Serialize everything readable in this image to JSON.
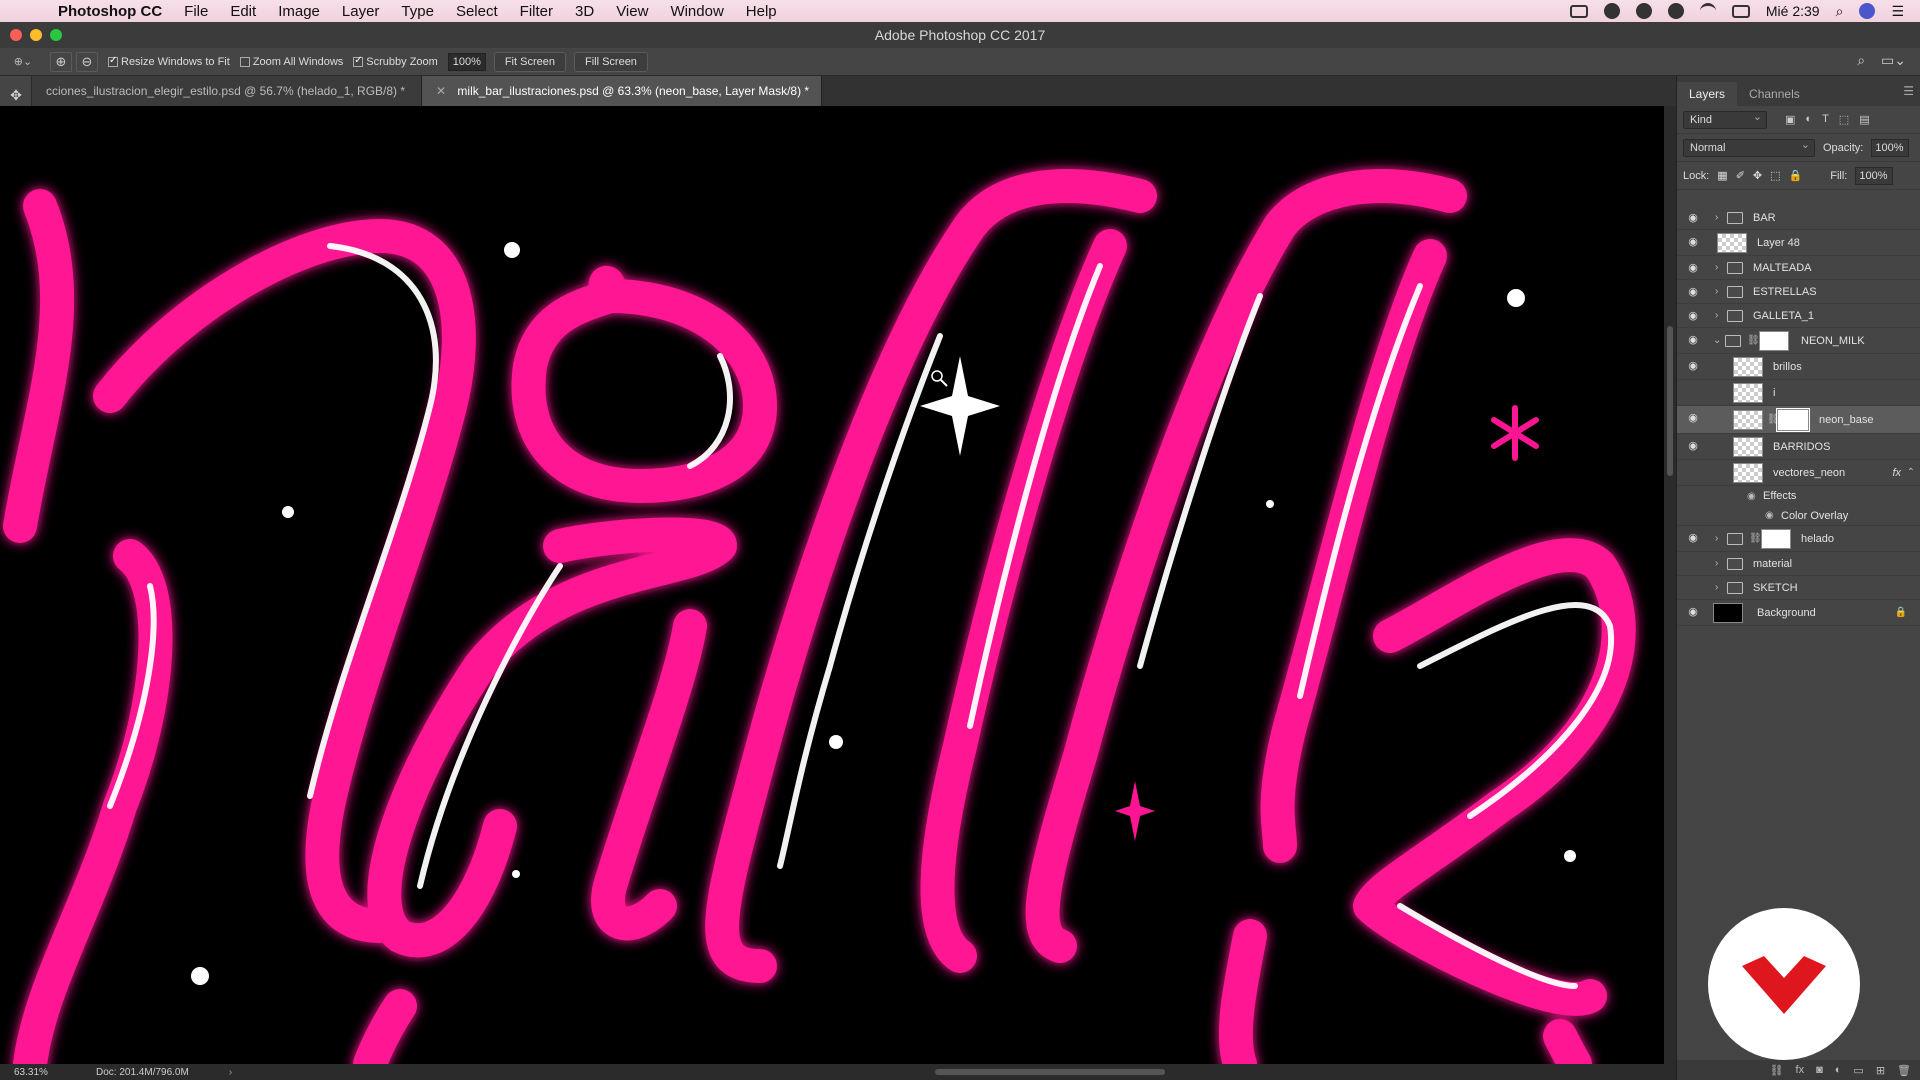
{
  "menubar": {
    "app_name": "Photoshop CC",
    "items": [
      "File",
      "Edit",
      "Image",
      "Layer",
      "Type",
      "Select",
      "Filter",
      "3D",
      "View",
      "Window",
      "Help"
    ],
    "clock": "Mié 2:39"
  },
  "window": {
    "title": "Adobe Photoshop CC 2017"
  },
  "options": {
    "resize_windows": "Resize Windows to Fit",
    "zoom_all": "Zoom All Windows",
    "scrubby_zoom": "Scrubby Zoom",
    "zoom_value": "100%",
    "fit_screen": "Fit Screen",
    "fill_screen": "Fill Screen"
  },
  "tabs": [
    {
      "label": "cciones_ilustracion_elegir_estilo.psd @ 56.7% (helado_1, RGB/8) *"
    },
    {
      "label": "milk_bar_ilustraciones.psd @ 63.3% (neon_base, Layer Mask/8) *"
    }
  ],
  "status": {
    "zoom": "63.31%",
    "doc": "Doc: 201.4M/796.0M"
  },
  "panel": {
    "tabs": [
      "Layers",
      "Channels"
    ],
    "filter_kind": "Kind",
    "blend_mode": "Normal",
    "opacity_label": "Opacity:",
    "opacity_value": "100%",
    "lock_label": "Lock:",
    "fill_label": "Fill:",
    "fill_value": "100%"
  },
  "layers": [
    {
      "name": "BAR"
    },
    {
      "name": "Layer 48"
    },
    {
      "name": "MALTEADA"
    },
    {
      "name": "ESTRELLAS"
    },
    {
      "name": "GALLETA_1"
    },
    {
      "name": "NEON_MILK"
    },
    {
      "name": "brillos"
    },
    {
      "name": "i"
    },
    {
      "name": "neon_base"
    },
    {
      "name": "BARRIDOS"
    },
    {
      "name": "vectores_neon"
    },
    {
      "name": "Effects"
    },
    {
      "name": "Color Overlay"
    },
    {
      "name": "helado"
    },
    {
      "name": "material"
    },
    {
      "name": "SKETCH"
    },
    {
      "name": "Background"
    }
  ],
  "colors": {
    "neon_pink": "#ff1493",
    "panel_bg": "#454545",
    "menubar_bg": "#f5dae6"
  }
}
